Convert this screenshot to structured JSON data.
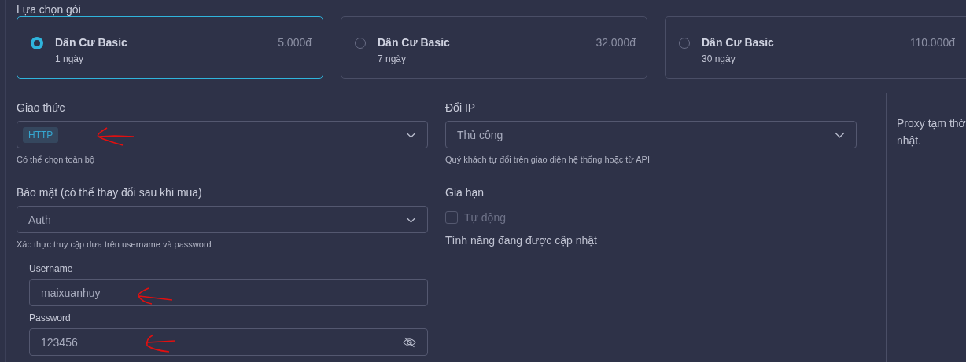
{
  "section_title": "Lựa chọn gói",
  "packages": [
    {
      "name": "Dân Cư Basic",
      "duration": "1 ngày",
      "price": "5.000đ",
      "selected": true
    },
    {
      "name": "Dân Cư Basic",
      "duration": "7 ngày",
      "price": "32.000đ",
      "selected": false
    },
    {
      "name": "Dân Cư Basic",
      "duration": "30 ngày",
      "price": "110.000đ",
      "selected": false
    }
  ],
  "protocol": {
    "label": "Giao thức",
    "tags": [
      "HTTP"
    ],
    "hint": "Có thể chọn toàn bộ"
  },
  "ip_change": {
    "label": "Đổi IP",
    "value": "Thủ công",
    "hint": "Quý khách tự đổi trên giao diện hệ thống hoặc từ API"
  },
  "security": {
    "label": "Bảo mật (có thể thay đổi sau khi mua)",
    "value": "Auth",
    "hint": "Xác thực truy cập dựa trên username và password",
    "username": {
      "label": "Username",
      "value": "maixuanhuy"
    },
    "password": {
      "label": "Password",
      "value": "123456"
    }
  },
  "renewal": {
    "label": "Gia hạn",
    "option": {
      "label": "Tự động",
      "checked": false,
      "disabled": true
    },
    "note": "Tính năng đang được cập nhật"
  },
  "side_note": {
    "lines": [
      "Proxy tạm thờ",
      "nhật."
    ]
  }
}
